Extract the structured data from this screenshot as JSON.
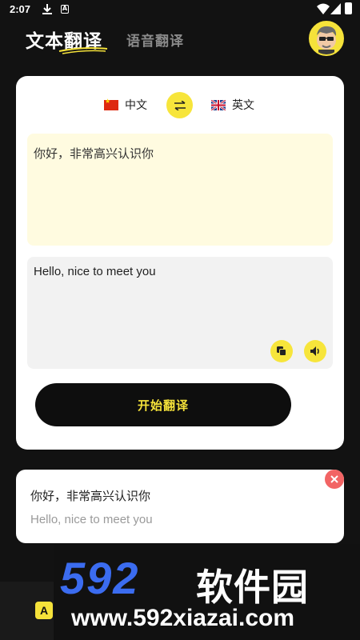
{
  "status_bar": {
    "time": "2:07",
    "notif_a": "A"
  },
  "header": {
    "tab_text": "文本翻译",
    "tab_voice": "语音翻译"
  },
  "languages": {
    "source": "中文",
    "target": "英文"
  },
  "input": {
    "text": "你好，非常高兴认识你"
  },
  "output": {
    "text": "Hello, nice to meet you"
  },
  "translate_button": "开始翻译",
  "history": {
    "source": "你好，非常高兴认识你",
    "target": "Hello, nice to meet you"
  },
  "bottom_nav": {
    "icon_letter": "A"
  },
  "watermark": {
    "logo": "592",
    "name": "软件园",
    "url": "www.592xiazai.com"
  },
  "icons": {
    "download": "download-icon",
    "wifi": "wifi-icon",
    "signal": "signal-icon",
    "battery": "battery-icon",
    "swap": "swap-icon",
    "copy": "copy-icon",
    "speaker": "speaker-icon",
    "close": "close-icon"
  },
  "colors": {
    "accent": "#f5e23a",
    "input_bg": "#fffbe0",
    "output_bg": "#f2f2f2",
    "delete": "#f26464",
    "background": "#121212"
  }
}
